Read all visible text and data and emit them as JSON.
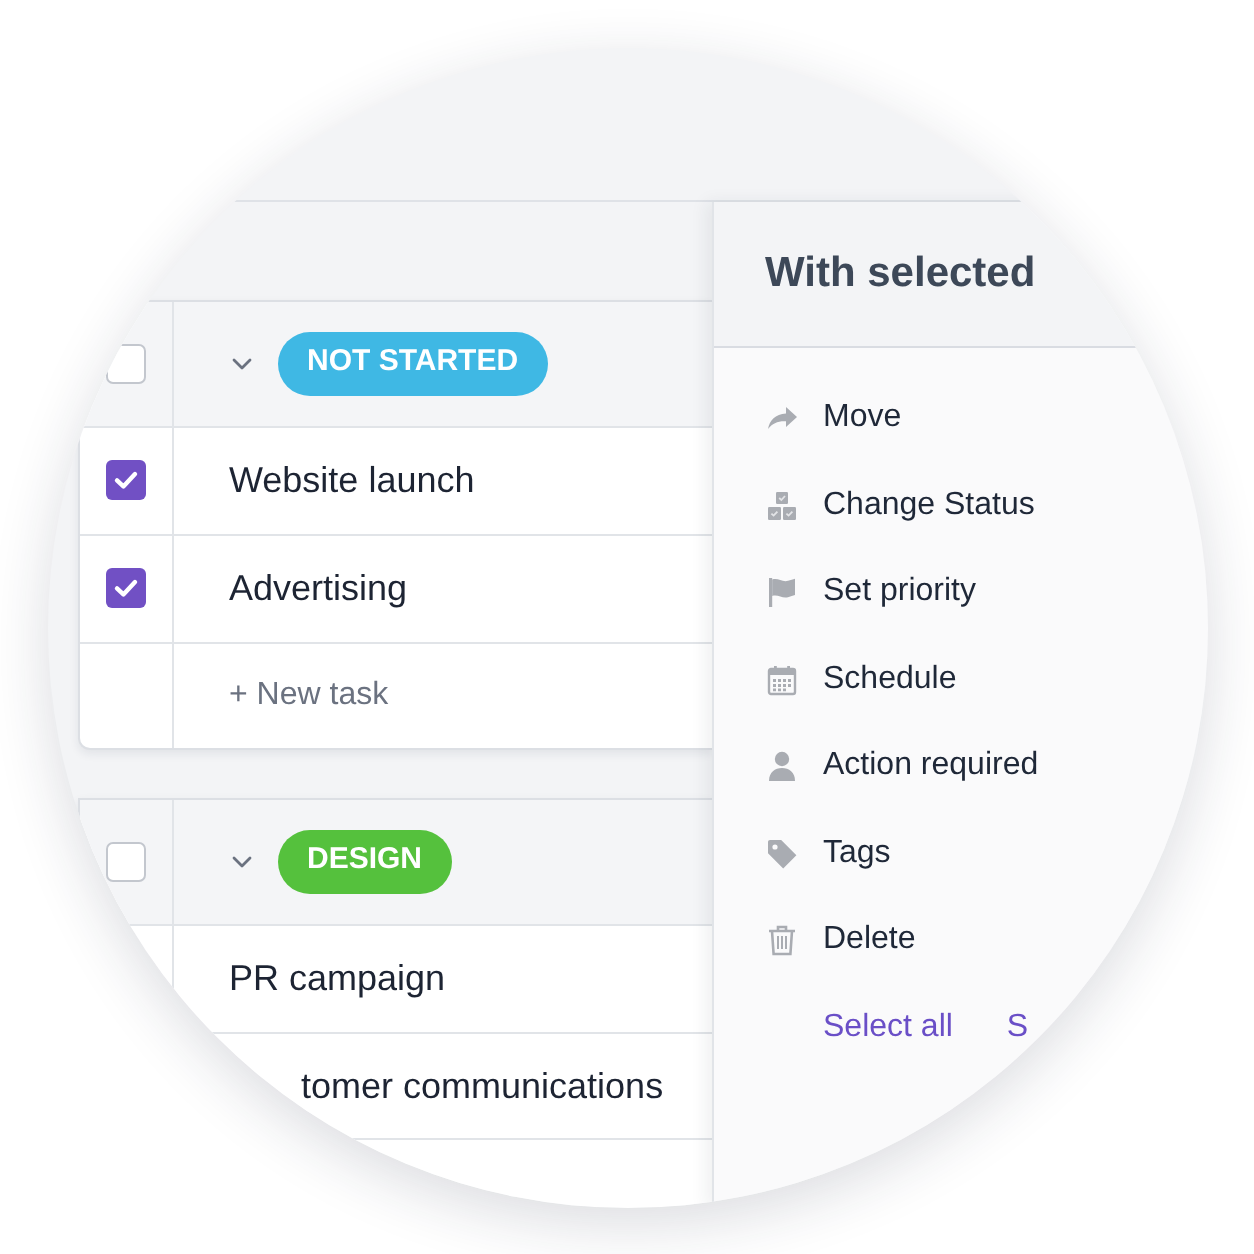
{
  "groups": [
    {
      "checked": false,
      "expanded": true,
      "status": {
        "label": "NOT STARTED",
        "color": "#3fb8e4"
      },
      "tasks": [
        {
          "title": "Website launch",
          "checked": true
        },
        {
          "title": "Advertising",
          "checked": true
        }
      ],
      "new_task": "+ New task"
    },
    {
      "checked": false,
      "expanded": true,
      "status": {
        "label": "DESIGN",
        "color": "#55c13d"
      },
      "tasks": [
        {
          "title": "PR campaign"
        },
        {
          "title": "tomer communications"
        }
      ]
    }
  ],
  "panel": {
    "title": "With selected",
    "actions": [
      "Move",
      "Change Status",
      "Set priority",
      "Schedule",
      "Action required",
      "Tags",
      "Delete"
    ],
    "links": [
      "Select all",
      "S"
    ]
  }
}
